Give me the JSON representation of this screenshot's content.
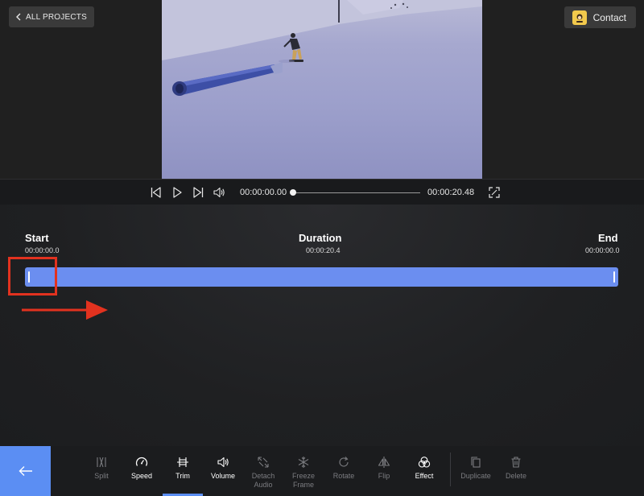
{
  "header": {
    "back_label": "ALL PROJECTS",
    "contact_label": "Contact"
  },
  "player": {
    "current_time": "00:00:00.00",
    "total_time": "00:00:20.48",
    "progress": 0
  },
  "trim": {
    "start_label": "Start",
    "start_time": "00:00:00.0",
    "duration_label": "Duration",
    "duration_time": "00:00:20.4",
    "end_label": "End",
    "end_time": "00:00:00.0"
  },
  "toolbar": {
    "tools": [
      {
        "label": "Split",
        "icon": "split-icon",
        "enabled": false
      },
      {
        "label": "Speed",
        "icon": "speed-icon",
        "enabled": true
      },
      {
        "label": "Trim",
        "icon": "trim-icon",
        "enabled": true,
        "active": true
      },
      {
        "label": "Volume",
        "icon": "volume-icon",
        "enabled": true
      },
      {
        "label": "Detach Audio",
        "icon": "detach-audio-icon",
        "enabled": false
      },
      {
        "label": "Freeze Frame",
        "icon": "freeze-frame-icon",
        "enabled": false
      },
      {
        "label": "Rotate",
        "icon": "rotate-icon",
        "enabled": false
      },
      {
        "label": "Flip",
        "icon": "flip-icon",
        "enabled": false
      },
      {
        "label": "Effect",
        "icon": "effect-icon",
        "enabled": true
      },
      {
        "label": "Duplicate",
        "icon": "duplicate-icon",
        "enabled": false
      },
      {
        "label": "Delete",
        "icon": "delete-icon",
        "enabled": false
      }
    ]
  },
  "colors": {
    "accent": "#5b8ef3",
    "trim_bar": "#6b8ef0",
    "annotation": "#e2321f"
  }
}
